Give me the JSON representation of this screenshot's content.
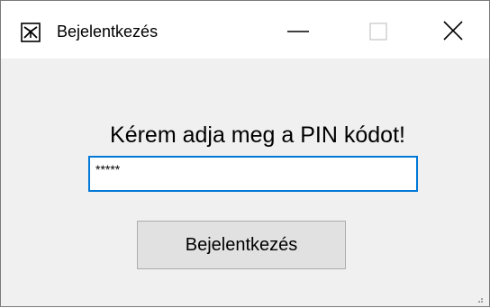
{
  "window": {
    "title": "Bejelentkezés",
    "icon": "key-icon"
  },
  "controls": {
    "minimize_icon": "minimize-icon",
    "maximize_icon": "maximize-icon",
    "close_icon": "close-icon"
  },
  "form": {
    "prompt": "Kérem adja meg a PIN kódot!",
    "pin_value": "*****",
    "login_label": "Bejelentkezés"
  },
  "colors": {
    "focus_border": "#0078d7",
    "button_bg": "#e1e1e1",
    "window_bg": "#f0f0f0"
  }
}
